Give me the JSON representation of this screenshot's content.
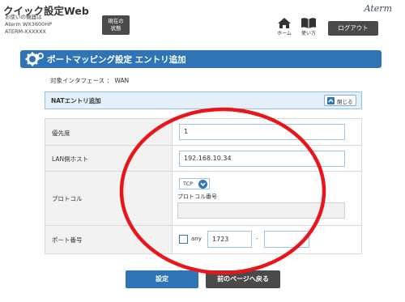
{
  "header": {
    "app_title": "クイック設定Web",
    "device_lines": [
      "お使いの機器は",
      "Aterm  WX3600HP",
      "ATERM-XXXXXX"
    ],
    "status_button": [
      "現在の",
      "状態"
    ],
    "brand": "Aterm",
    "nav": [
      {
        "label": "ホーム",
        "icon": "home-icon"
      },
      {
        "label": "使い方",
        "icon": "book-icon"
      }
    ],
    "logout_label": "ログアウト"
  },
  "page": {
    "title": "ポートマッピング設定 エントリ追加",
    "interface_line": "対象インタフェース ： WAN"
  },
  "section": {
    "title": "NATエントリ追加",
    "close_label": "閉じる"
  },
  "form": {
    "priority": {
      "label": "優先度",
      "value": "1"
    },
    "lan_host": {
      "label": "LAN側ホスト",
      "value": "192.168.10.34"
    },
    "protocol": {
      "label": "プロトコル",
      "selected": "TCP",
      "number_label": "プロトコル番号",
      "number_value": ""
    },
    "port": {
      "label": "ポート番号",
      "any_label": "any",
      "any_checked": false,
      "from": "1723",
      "separator": "-",
      "to": ""
    }
  },
  "buttons": {
    "submit": "設定",
    "back": "前のページへ戻る"
  },
  "annotation": {
    "color": "#e8161b"
  },
  "colors": {
    "accent": "#2f75b5",
    "dark_button": "#4a4a4a"
  }
}
